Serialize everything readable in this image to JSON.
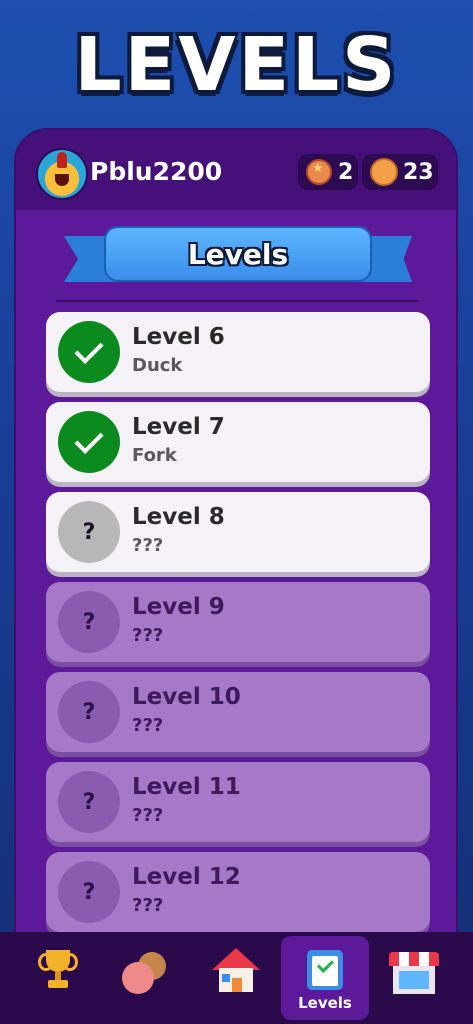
{
  "header": {
    "title": "LEVELS"
  },
  "profile": {
    "username": "Pblu2200",
    "medals": "2",
    "coins": "23"
  },
  "banner": {
    "label": "Levels"
  },
  "levels": [
    {
      "name": "Level 6",
      "word": "Duck",
      "state": "done"
    },
    {
      "name": "Level 7",
      "word": "Fork",
      "state": "done"
    },
    {
      "name": "Level 8",
      "word": "???",
      "state": "current"
    },
    {
      "name": "Level 9",
      "word": "???",
      "state": "locked"
    },
    {
      "name": "Level 10",
      "word": "???",
      "state": "locked"
    },
    {
      "name": "Level 11",
      "word": "???",
      "state": "locked"
    },
    {
      "name": "Level 12",
      "word": "???",
      "state": "locked"
    }
  ],
  "status_marks": {
    "locked": "?"
  },
  "nav": {
    "items": [
      {
        "icon": "trophy-icon",
        "label": ""
      },
      {
        "icon": "friends-icon",
        "label": ""
      },
      {
        "icon": "home-icon",
        "label": ""
      },
      {
        "icon": "clipboard-check-icon",
        "label": "Levels",
        "active": true
      },
      {
        "icon": "shop-icon",
        "label": ""
      }
    ]
  },
  "colors": {
    "background": "#1d4fb0",
    "panel": "#5c1a9a",
    "done": "#0b8b1e",
    "locked_row": "#a578c8"
  }
}
